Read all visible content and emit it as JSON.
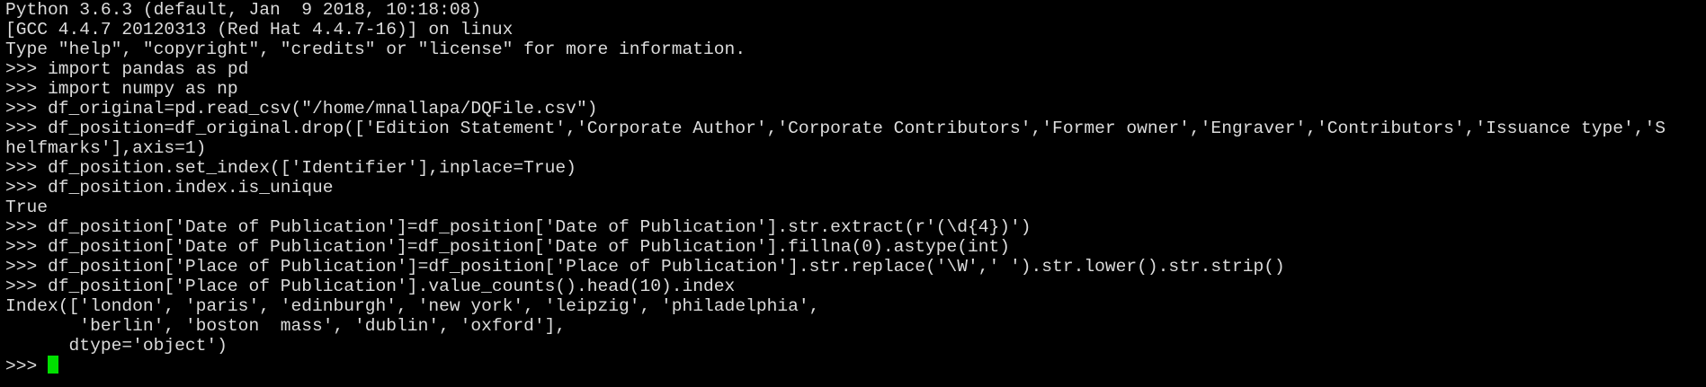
{
  "terminal": {
    "lines": [
      "Python 3.6.3 (default, Jan  9 2018, 10:18:08)",
      "[GCC 4.4.7 20120313 (Red Hat 4.4.7-16)] on linux",
      "Type \"help\", \"copyright\", \"credits\" or \"license\" for more information.",
      ">>> import pandas as pd",
      ">>> import numpy as np",
      ">>> df_original=pd.read_csv(\"/home/mnallapa/DQFile.csv\")",
      ">>> df_position=df_original.drop(['Edition Statement','Corporate Author','Corporate Contributors','Former owner','Engraver','Contributors','Issuance type','S",
      "helfmarks'],axis=1)",
      ">>> df_position.set_index(['Identifier'],inplace=True)",
      ">>> df_position.index.is_unique",
      "True",
      ">>> df_position['Date of Publication']=df_position['Date of Publication'].str.extract(r'(\\d{4})')",
      ">>> df_position['Date of Publication']=df_position['Date of Publication'].fillna(0).astype(int)",
      ">>> df_position['Place of Publication']=df_position['Place of Publication'].str.replace('\\W',' ').str.lower().str.strip()",
      ">>> df_position['Place of Publication'].value_counts().head(10).index",
      "Index(['london', 'paris', 'edinburgh', 'new york', 'leipzig', 'philadelphia',",
      "       'berlin', 'boston  mass', 'dublin', 'oxford'],",
      "      dtype='object')"
    ],
    "prompt": ">>> ",
    "colors": {
      "background": "#000000",
      "foreground": "#dcdcdc",
      "cursor": "#00e000"
    }
  }
}
